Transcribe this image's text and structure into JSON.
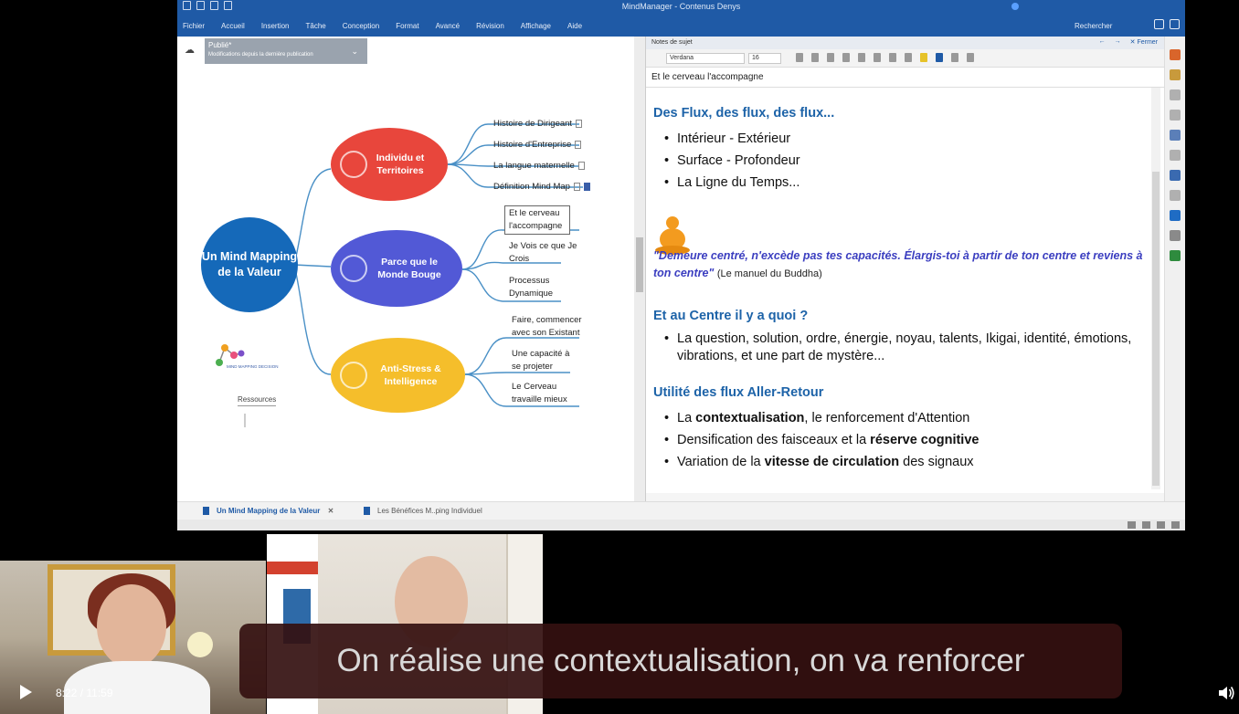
{
  "app": {
    "title": "MindManager - Contenus Denys",
    "account": "",
    "menu": [
      "Fichier",
      "Accueil",
      "Insertion",
      "Tâche",
      "Conception",
      "Format",
      "Avancé",
      "Révision",
      "Affichage",
      "Aide"
    ],
    "search_label": "Rechercher"
  },
  "publish": {
    "label": "Publié*",
    "sub": "Modifications depuis la dernière publication"
  },
  "map": {
    "central": "Un Mind Mapping de la Valeur",
    "branches": [
      {
        "label": "Individu et Territoires",
        "color": "#e8463c",
        "leaves": [
          "Histoire de Dirigeant",
          "Histoire d'Entreprise",
          "La langue maternelle",
          "Définition Mind Map"
        ]
      },
      {
        "label": "Parce que le Monde Bouge",
        "color": "#5259d6",
        "leaves": [
          "Et le cerveau l'accompagne",
          "Je Vois ce que Je Crois",
          "Processus Dynamique"
        ]
      },
      {
        "label": "Anti-Stress & Intelligence",
        "color": "#f5be2b",
        "leaves": [
          "Faire, commencer avec son Existant",
          "Une capacité à se projeter",
          "Le Cerveau travaille mieux"
        ]
      }
    ],
    "central_color": "#1569b9",
    "logo_text": "MIND MAPPING DECISION",
    "ressources": "Ressources"
  },
  "notes": {
    "panel_title": "Notes de sujet",
    "close_label": "Fermer",
    "font": "Verdana",
    "size": "16",
    "topic": "Et le cerveau l'accompagne",
    "sections": [
      {
        "heading": "Des Flux, des flux, des flux...",
        "bullets": [
          "Intérieur - Extérieur",
          "Surface - Profondeur",
          "La Ligne du Temps..."
        ]
      }
    ],
    "quote": "\"Demeure centré, n'excède pas tes capacités. Élargis-toi à partir de ton centre et reviens à ton centre\"",
    "quote_source": "(Le manuel du Buddha)",
    "section2_heading": "Et au Centre il y a quoi ?",
    "section2_bullet": "La question, solution, ordre, énergie, noyau, talents, Ikigai, identité, émotions, vibrations, et une part de mystère...",
    "section3_heading": "Utilité des flux Aller-Retour",
    "section3_bullets": [
      {
        "pre": "La ",
        "bold": "contextualisation",
        "post": ", le renforcement d'Attention"
      },
      {
        "pre": "Densification des faisceaux et la ",
        "bold": "réserve cognitive",
        "post": ""
      },
      {
        "pre": "Variation de la ",
        "bold": "vitesse de circulation",
        "post": " des signaux"
      }
    ]
  },
  "tabs": [
    "Un Mind Mapping de la Valeur",
    "Les Bénéfices M..ping Individuel"
  ],
  "video": {
    "caption": "On réalise une contextualisation, on va renforcer",
    "time": "8:22 / 11:59"
  }
}
